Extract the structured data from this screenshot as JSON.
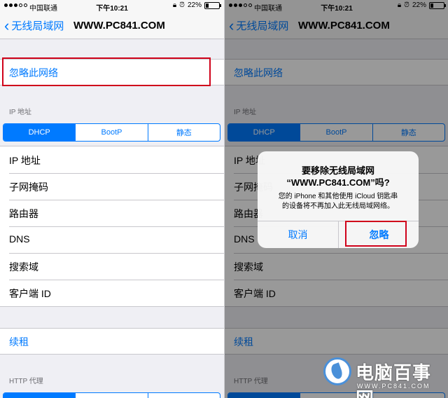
{
  "status_bar": {
    "carrier": "中国联通",
    "time": "下午10:21",
    "battery": "22%",
    "battery_level": 0.22,
    "lock_icon": "lock-rotation-icon",
    "alarm_icon": "alarm-clock-icon"
  },
  "nav": {
    "back_label": "无线局域网",
    "title": "WWW.PC841.COM"
  },
  "forget_label": "忽略此网络",
  "ip_section": {
    "header": "IP 地址",
    "tabs": [
      "DHCP",
      "BootP",
      "静态"
    ],
    "active_tab": "DHCP",
    "rows": [
      "IP 地址",
      "子网掩码",
      "路由器",
      "DNS",
      "搜索域",
      "客户端 ID"
    ]
  },
  "renew_label": "续租",
  "http_header": "HTTP 代理",
  "alert": {
    "title_line1": "要移除无线局域网",
    "title_line2": "“WWW.PC841.COM”吗?",
    "message_line1": "您的 iPhone 和其他使用 iCloud 钥匙串",
    "message_line2": "的设备将不再加入此无线局域网络。",
    "cancel_label": "取消",
    "ignore_label": "忽略"
  },
  "watermark": {
    "text": "电脑百事网",
    "url": "WWW.PC841.COM"
  },
  "colors": {
    "accent": "#007aff",
    "highlight_box": "#d0021b",
    "background": "#efeff4"
  }
}
